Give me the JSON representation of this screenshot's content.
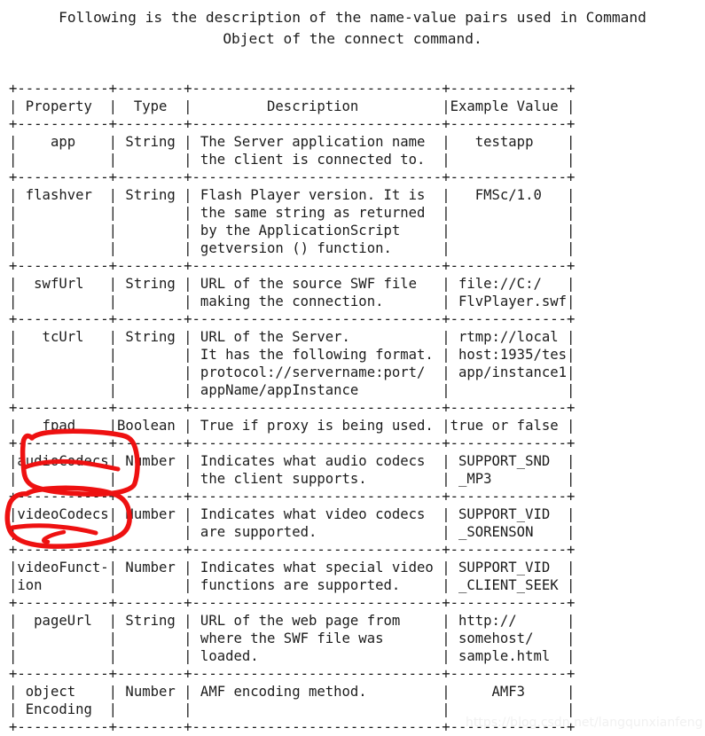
{
  "intro": {
    "line1": "Following is the description of the name-value pairs used in Command",
    "line2": "Object of the connect command."
  },
  "table": {
    "columns": [
      "Property",
      "Type",
      "Description",
      "Example Value"
    ],
    "rows": [
      {
        "property": "app",
        "type": "String",
        "description": [
          "The Server application name",
          "the client is connected to."
        ],
        "example": [
          "testapp"
        ]
      },
      {
        "property": "flashver",
        "type": "String",
        "description": [
          "Flash Player version. It is",
          "the same string as returned",
          "by the ApplicationScript",
          "getversion () function."
        ],
        "example": [
          "FMSc/1.0"
        ]
      },
      {
        "property": "swfUrl",
        "type": "String",
        "description": [
          "URL of the source SWF file",
          "making the connection."
        ],
        "example": [
          "file://C:/",
          "FlvPlayer.swf"
        ]
      },
      {
        "property": "tcUrl",
        "type": "String",
        "description": [
          "URL of the Server.",
          "It has the following format.",
          "protocol://servername:port/",
          "appName/appInstance"
        ],
        "example": [
          "rtmp://local",
          "host:1935/test",
          "app/instance1"
        ]
      },
      {
        "property": "fpad",
        "type": "Boolean",
        "description": [
          "True if proxy is being used."
        ],
        "example": [
          "true or false"
        ]
      },
      {
        "property": "audioCodecs",
        "type": "Number",
        "description": [
          "Indicates what audio codecs",
          "the client supports."
        ],
        "example": [
          "SUPPORT_SND",
          "_MP3"
        ],
        "annotated": true
      },
      {
        "property": "videoCodecs",
        "type": "Number",
        "description": [
          "Indicates what video codecs",
          "are supported."
        ],
        "example": [
          "SUPPORT_VID",
          "_SORENSON"
        ],
        "annotated": true
      },
      {
        "property": "videoFunct-ion",
        "type": "Number",
        "description": [
          "Indicates what special video",
          "functions are supported."
        ],
        "example": [
          "SUPPORT_VID",
          "_CLIENT_SEEK"
        ]
      },
      {
        "property": "pageUrl",
        "type": "String",
        "description": [
          "URL of the web page from",
          "where the SWF file was",
          "loaded."
        ],
        "example": [
          "http://",
          "somehost/",
          "sample.html"
        ]
      },
      {
        "property": "object Encoding",
        "type": "Number",
        "description": [
          "AMF encoding method."
        ],
        "example": [
          "AMF3"
        ]
      }
    ],
    "ascii": "+----------+-------+----------------------------+-------------+\n| Property |  Type |         Description        | Example Value |\n+----------+-------+----------------------------+-------------+"
  },
  "ascii_art": "+----------+--------+----------------------------+-------------+\n| Property |  Type  |        Description         | Example Value |\n+----------+--------+----------------------------+-------------+",
  "annotations": {
    "color": "#ee1111",
    "items": [
      {
        "target": "audioCodecs",
        "shape": "hand-drawn-ellipse"
      },
      {
        "target": "videoCodecs",
        "shape": "hand-drawn-ellipse"
      }
    ]
  },
  "watermark": {
    "text": "https://blog.csdn.net/langqunxianfeng"
  }
}
